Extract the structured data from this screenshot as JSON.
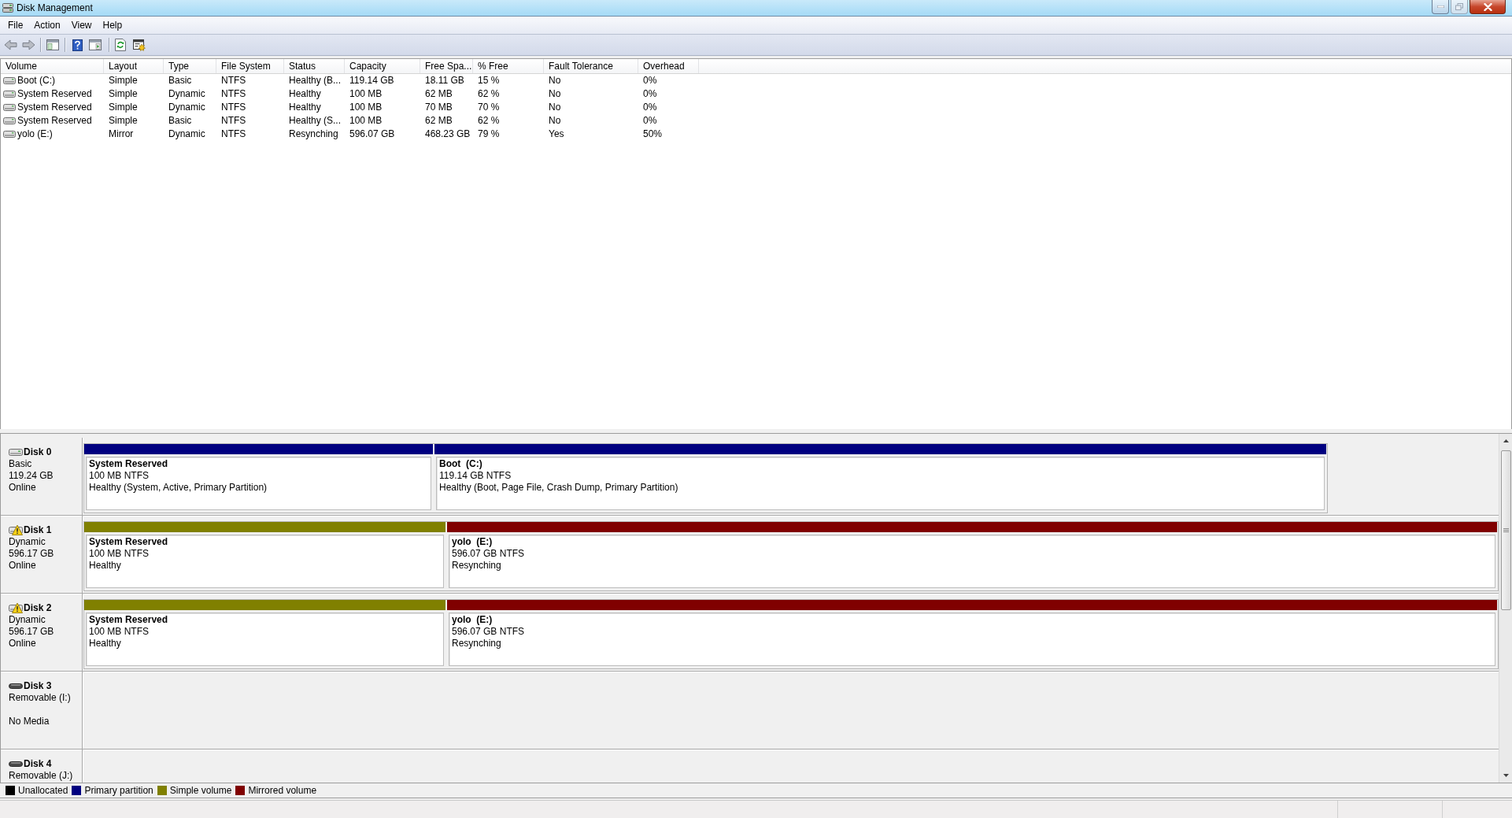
{
  "window": {
    "title": "Disk Management"
  },
  "menu": [
    "File",
    "Action",
    "View",
    "Help"
  ],
  "volume_table": {
    "columns": [
      "Volume",
      "Layout",
      "Type",
      "File System",
      "Status",
      "Capacity",
      "Free Spa...",
      "% Free",
      "Fault Tolerance",
      "Overhead"
    ],
    "rows": [
      [
        "Boot (C:)",
        "Simple",
        "Basic",
        "NTFS",
        "Healthy (B...",
        "119.14 GB",
        "18.11 GB",
        "15 %",
        "No",
        "0%"
      ],
      [
        "System Reserved",
        "Simple",
        "Dynamic",
        "NTFS",
        "Healthy",
        "100 MB",
        "62 MB",
        "62 %",
        "No",
        "0%"
      ],
      [
        "System Reserved",
        "Simple",
        "Dynamic",
        "NTFS",
        "Healthy",
        "100 MB",
        "70 MB",
        "70 %",
        "No",
        "0%"
      ],
      [
        "System Reserved",
        "Simple",
        "Basic",
        "NTFS",
        "Healthy (S...",
        "100 MB",
        "62 MB",
        "62 %",
        "No",
        "0%"
      ],
      [
        "yolo (E:)",
        "Mirror",
        "Dynamic",
        "NTFS",
        "Resynching",
        "596.07 GB",
        "468.23 GB",
        "79 %",
        "Yes",
        "50%"
      ]
    ]
  },
  "disks": [
    {
      "name": "Disk 0",
      "kind": "fixed",
      "warning": false,
      "type": "Basic",
      "size": "119.24 GB",
      "status": "Online",
      "partitions": [
        {
          "name": "System Reserved",
          "detail": "100 MB NTFS",
          "status": "Healthy (System, Active, Primary Partition)",
          "color": "#000080"
        },
        {
          "name": "Boot  (C:)",
          "detail": "119.14 GB NTFS",
          "status": "Healthy (Boot, Page File, Crash Dump, Primary Partition)",
          "color": "#000080"
        }
      ]
    },
    {
      "name": "Disk 1",
      "kind": "fixed",
      "warning": true,
      "type": "Dynamic",
      "size": "596.17 GB",
      "status": "Online",
      "partitions": [
        {
          "name": "System Reserved",
          "detail": "100 MB NTFS",
          "status": "Healthy",
          "color": "#808000"
        },
        {
          "name": "yolo  (E:)",
          "detail": "596.07 GB NTFS",
          "status": "Resynching",
          "color": "#800000"
        }
      ]
    },
    {
      "name": "Disk 2",
      "kind": "fixed",
      "warning": true,
      "type": "Dynamic",
      "size": "596.17 GB",
      "status": "Online",
      "partitions": [
        {
          "name": "System Reserved",
          "detail": "100 MB NTFS",
          "status": "Healthy",
          "color": "#808000"
        },
        {
          "name": "yolo  (E:)",
          "detail": "596.07 GB NTFS",
          "status": "Resynching",
          "color": "#800000"
        }
      ]
    },
    {
      "name": "Disk 3",
      "kind": "removable",
      "warning": false,
      "type": "Removable (I:)",
      "status": "No Media"
    },
    {
      "name": "Disk 4",
      "kind": "removable",
      "warning": false,
      "type": "Removable (J:)"
    }
  ],
  "legend": [
    {
      "label": "Unallocated",
      "color": "#000000"
    },
    {
      "label": "Primary partition",
      "color": "#000080"
    },
    {
      "label": "Simple volume",
      "color": "#808000"
    },
    {
      "label": "Mirrored volume",
      "color": "#800000"
    }
  ]
}
